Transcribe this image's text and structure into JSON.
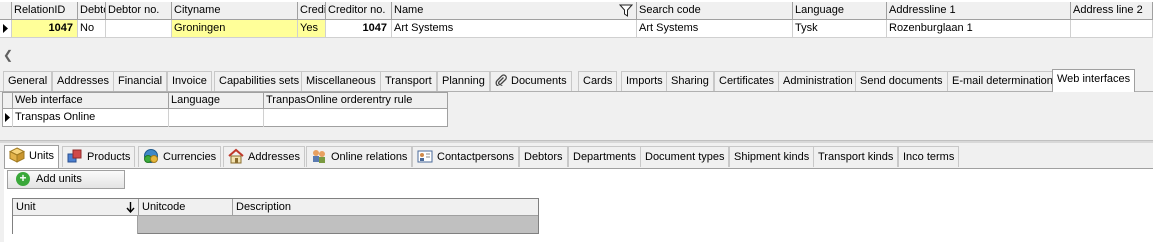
{
  "top_grid": {
    "columns": [
      "RelationID",
      "Debtor",
      "Debtor no.",
      "Cityname",
      "Creditor",
      "Creditor no.",
      "Name",
      "Search code",
      "Language",
      "Addressline 1",
      "Address line 2"
    ],
    "row": {
      "relation_id": "1047",
      "debtor": "No",
      "debtor_no": "",
      "cityname": "Groningen",
      "creditor": "Yes",
      "creditor_no": "1047",
      "name": "Art Systems",
      "search_code": "Art Systems",
      "language": "Tysk",
      "addressline1": "Rozenburglaan 1",
      "addressline2": ""
    }
  },
  "main_tabs": [
    "General",
    "Addresses",
    "Financial",
    "Invoice",
    "Capabilities sets",
    "Miscellaneous",
    "Transport",
    "Planning",
    "Documents",
    "Cards",
    "Imports",
    "Sharing",
    "Certificates",
    "Administration",
    "Send documents",
    "E-mail determination",
    "Web interfaces"
  ],
  "web_interfaces": {
    "columns": [
      "Web interface",
      "Language",
      "TranpasOnline orderentry rule"
    ],
    "row": {
      "web_interface": "Transpas Online",
      "language": "",
      "rule": ""
    }
  },
  "sub_tabs": [
    "Units",
    "Products",
    "Currencies",
    "Addresses",
    "Online relations",
    "Contactpersons",
    "Debtors",
    "Departments",
    "Document types",
    "Shipment kinds",
    "Transport kinds",
    "Inco terms"
  ],
  "add_units_label": "Add units",
  "units_grid": {
    "columns": [
      "Unit",
      "Unitcode",
      "Description"
    ]
  }
}
